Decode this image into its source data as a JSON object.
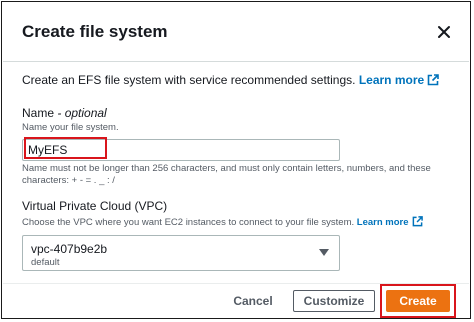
{
  "dialog": {
    "title": "Create file system",
    "description": "Create an EFS file system with service recommended settings.",
    "description_link": "Learn more"
  },
  "name_field": {
    "label": "Name",
    "label_optional": "- optional",
    "hint": "Name your file system.",
    "value": "MyEFS",
    "constraint_line1": "Name must not be longer than 256 characters, and must only contain letters, numbers, and these",
    "constraint_line2": "characters: + - = . _ : /"
  },
  "vpc_field": {
    "label": "Virtual Private Cloud (VPC)",
    "hint": "Choose the VPC where you want EC2 instances to connect to your file system.",
    "hint_link": "Learn more",
    "selected_value": "vpc-407b9e2b",
    "selected_sub": "default"
  },
  "footer": {
    "cancel_label": "Cancel",
    "customize_label": "Customize",
    "create_label": "Create"
  },
  "colors": {
    "accent": "#ec7211",
    "link": "#0073bb",
    "highlight": "#d9151c"
  },
  "icons": [
    "close-icon",
    "external-link-icon",
    "caret-down-icon"
  ]
}
